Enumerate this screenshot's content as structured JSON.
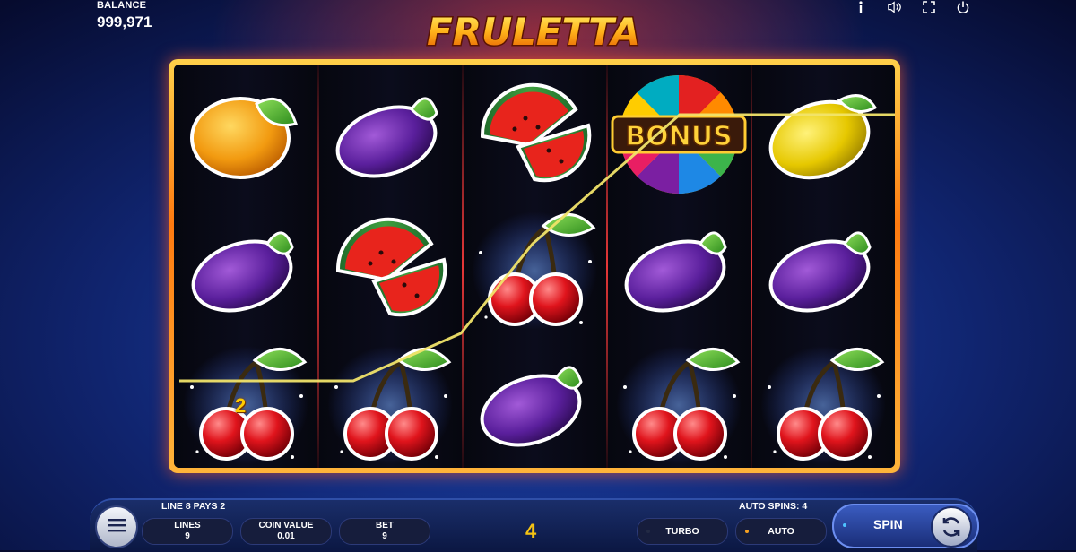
{
  "balance": {
    "label": "BALANCE",
    "value": "999,971"
  },
  "logo": {
    "text": "FRULETTA"
  },
  "top_icons": [
    "info-icon",
    "sound-icon",
    "fullscreen-icon",
    "power-icon"
  ],
  "reels": [
    [
      "orange",
      "plum",
      "cherry"
    ],
    [
      "plum",
      "watermelon",
      "cherry"
    ],
    [
      "watermelon",
      "cherry",
      "plum"
    ],
    [
      "bonus",
      "plum",
      "cherry"
    ],
    [
      "lemon",
      "plum",
      "cherry"
    ]
  ],
  "bonus_label": "BONUS",
  "multiplier": "2",
  "messages": {
    "line_win": "LINE 8 PAYS 2",
    "auto_spins": "AUTO SPINS: 4"
  },
  "controls": {
    "lines": {
      "label": "LINES",
      "value": "9"
    },
    "coin_value": {
      "label": "COIN VALUE",
      "value": "0.01"
    },
    "bet": {
      "label": "BET",
      "value": "9"
    },
    "win": "4",
    "turbo": "TURBO",
    "auto": "AUTO",
    "spin": "SPIN"
  },
  "colors": {
    "win": "#f5c313",
    "auto_dot": "#f5a020",
    "spin_dot": "#4ec3ff",
    "frame": "#ff7a10"
  }
}
